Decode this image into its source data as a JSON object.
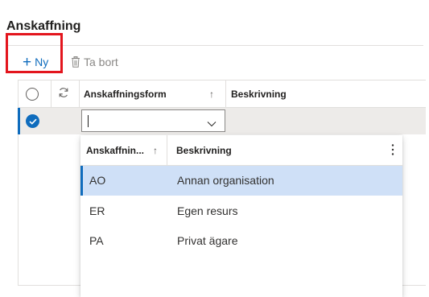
{
  "page": {
    "title": "Anskaffning"
  },
  "toolbar": {
    "new_label": "Ny",
    "delete_label": "Ta bort"
  },
  "grid": {
    "columns": {
      "form": "Anskaffningsform",
      "description": "Beskrivning"
    },
    "sort_indicator": "↑",
    "row": {
      "selected": true,
      "form_value": ""
    }
  },
  "dropdown": {
    "columns": {
      "code": "Anskaffnin...",
      "description": "Beskrivning"
    },
    "sort_indicator": "↑",
    "rows": [
      {
        "code": "AO",
        "description": "Annan organisation",
        "selected": true
      },
      {
        "code": "ER",
        "description": "Egen resurs",
        "selected": false
      },
      {
        "code": "PA",
        "description": "Privat ägare",
        "selected": false
      }
    ]
  },
  "colors": {
    "accent": "#0f6cbd",
    "highlight": "#e3151d",
    "selected_row": "#cfe0f7"
  }
}
